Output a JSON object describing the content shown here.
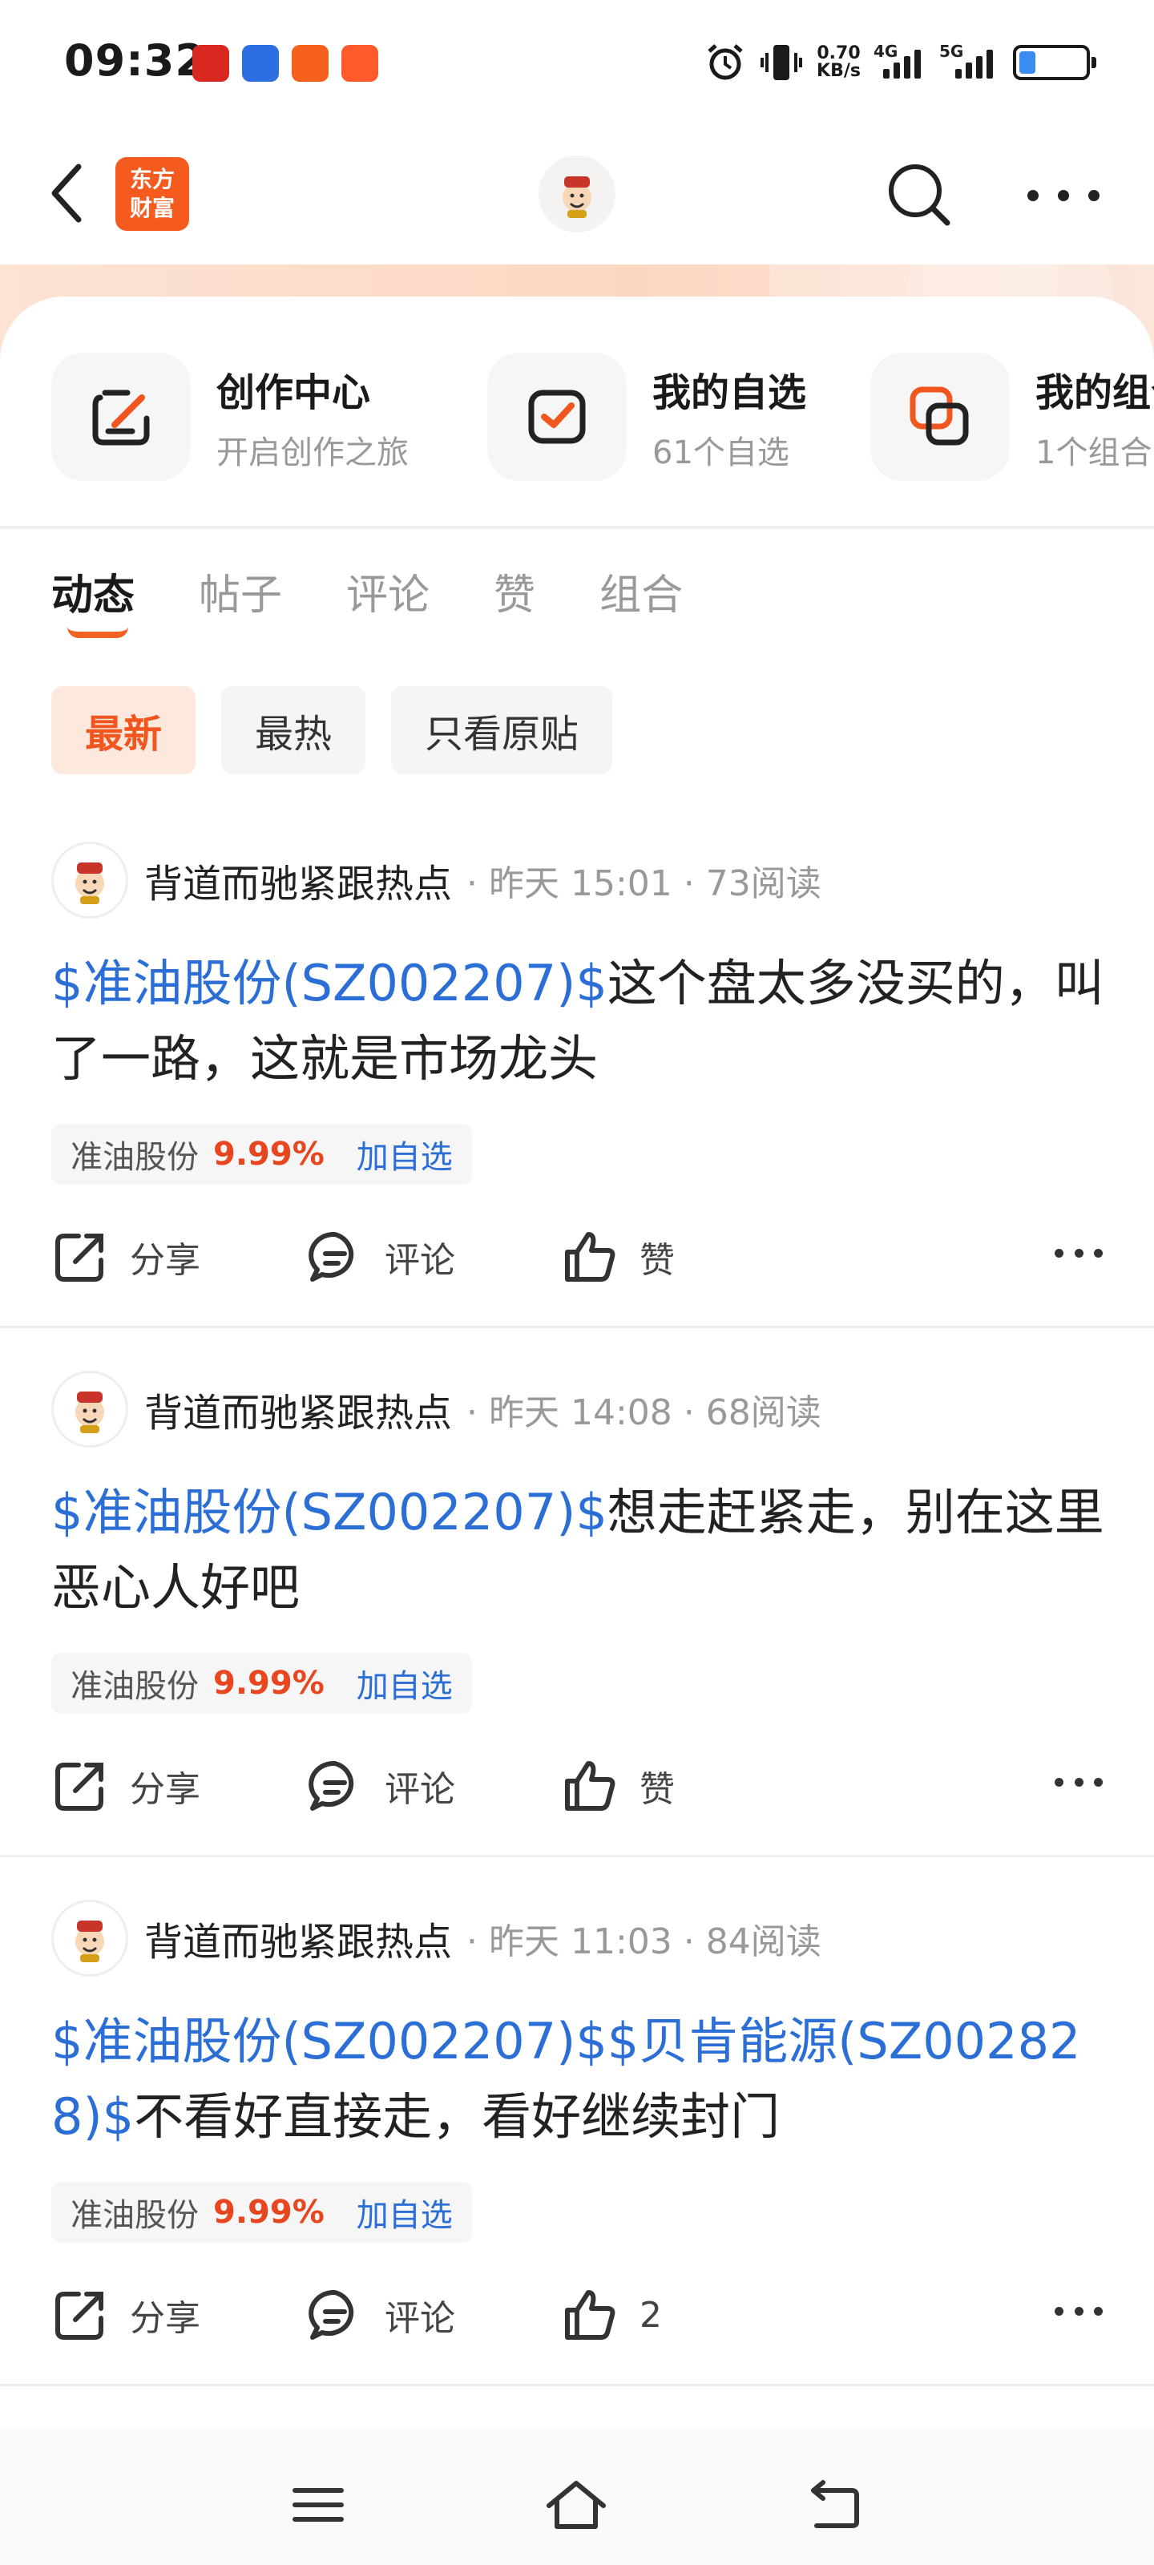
{
  "status_bar": {
    "time": "09:32",
    "net_speed_value": "0.70",
    "net_speed_unit": "KB/s",
    "net_4g": "4G",
    "net_5g": "5G",
    "battery_level": 0.25,
    "app_icons": [
      "app-icon-red",
      "app-icon-blue",
      "app-icon-orange",
      "app-icon-taobao"
    ]
  },
  "header": {
    "brand": [
      "东方",
      "财富"
    ]
  },
  "quick_actions": [
    {
      "title": "创作中心",
      "subtitle": "开启创作之旅",
      "icon": "create-icon"
    },
    {
      "title": "我的自选",
      "subtitle": "61个自选",
      "icon": "watchlist-icon"
    },
    {
      "title": "我的组合",
      "subtitle": "1个组合",
      "icon": "portfolio-icon"
    }
  ],
  "tabs": [
    {
      "label": "动态",
      "active": true
    },
    {
      "label": "帖子",
      "active": false
    },
    {
      "label": "评论",
      "active": false
    },
    {
      "label": "赞",
      "active": false
    },
    {
      "label": "组合",
      "active": false
    }
  ],
  "filters": [
    {
      "label": "最新",
      "active": true
    },
    {
      "label": "最热",
      "active": false
    },
    {
      "label": "只看原贴",
      "active": false
    }
  ],
  "posts": [
    {
      "author": "背道而驰紧跟热点",
      "meta": "· 昨天 15:01 · 73阅读",
      "link": "$准油股份(SZ002207)$",
      "text": "这个盘太多没买的，叫了一路，这就是市场龙头",
      "stock_name": "准油股份",
      "stock_pct": "9.99%",
      "add_label": "加自选",
      "share": "分享",
      "comment": "评论",
      "like": "赞"
    },
    {
      "author": "背道而驰紧跟热点",
      "meta": "· 昨天 14:08 · 68阅读",
      "link": "$准油股份(SZ002207)$",
      "text": "想走赶紧走，别在这里恶心人好吧",
      "stock_name": "准油股份",
      "stock_pct": "9.99%",
      "add_label": "加自选",
      "share": "分享",
      "comment": "评论",
      "like": "赞"
    },
    {
      "author": "背道而驰紧跟热点",
      "meta": "· 昨天 11:03 · 84阅读",
      "link": "$准油股份(SZ002207)$$贝肯能源(SZ002828)$",
      "text": "不看好直接走，看好继续封门",
      "stock_name": "准油股份",
      "stock_pct": "9.99%",
      "add_label": "加自选",
      "share": "分享",
      "comment": "评论",
      "like": "2"
    }
  ],
  "colors": {
    "accent": "#f0561d",
    "link": "#2b6fd6",
    "up": "#e8461e"
  }
}
